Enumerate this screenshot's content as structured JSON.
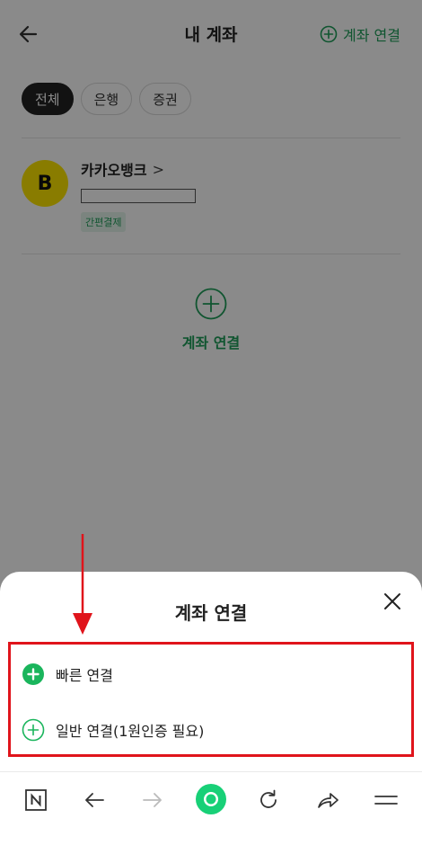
{
  "header": {
    "title": "내 계좌",
    "connect_label": "계좌 연결"
  },
  "tabs": [
    {
      "label": "전체",
      "active": true
    },
    {
      "label": "은행",
      "active": false
    },
    {
      "label": "증권",
      "active": false
    }
  ],
  "account": {
    "bank_name": "카카오뱅크",
    "chevron": ">",
    "logo_letter": "B",
    "badge": "간편결제",
    "logo_color": "#fee500"
  },
  "center_add": {
    "label": "계좌 연결"
  },
  "sheet": {
    "title": "계좌 연결",
    "options": [
      {
        "label": "빠른 연결",
        "icon": "plus-filled-icon"
      },
      {
        "label": "일반 연결(1원인증 필요)",
        "icon": "plus-outline-icon"
      }
    ]
  },
  "browser_bar": {
    "icons": [
      "naver-n-icon",
      "back-arrow-icon",
      "forward-arrow-icon",
      "home-dot-icon",
      "refresh-icon",
      "share-icon",
      "menu-icon"
    ]
  },
  "colors": {
    "accent": "#1e9e5a",
    "highlight": "#e0141b",
    "dark_tab": "#222222"
  }
}
